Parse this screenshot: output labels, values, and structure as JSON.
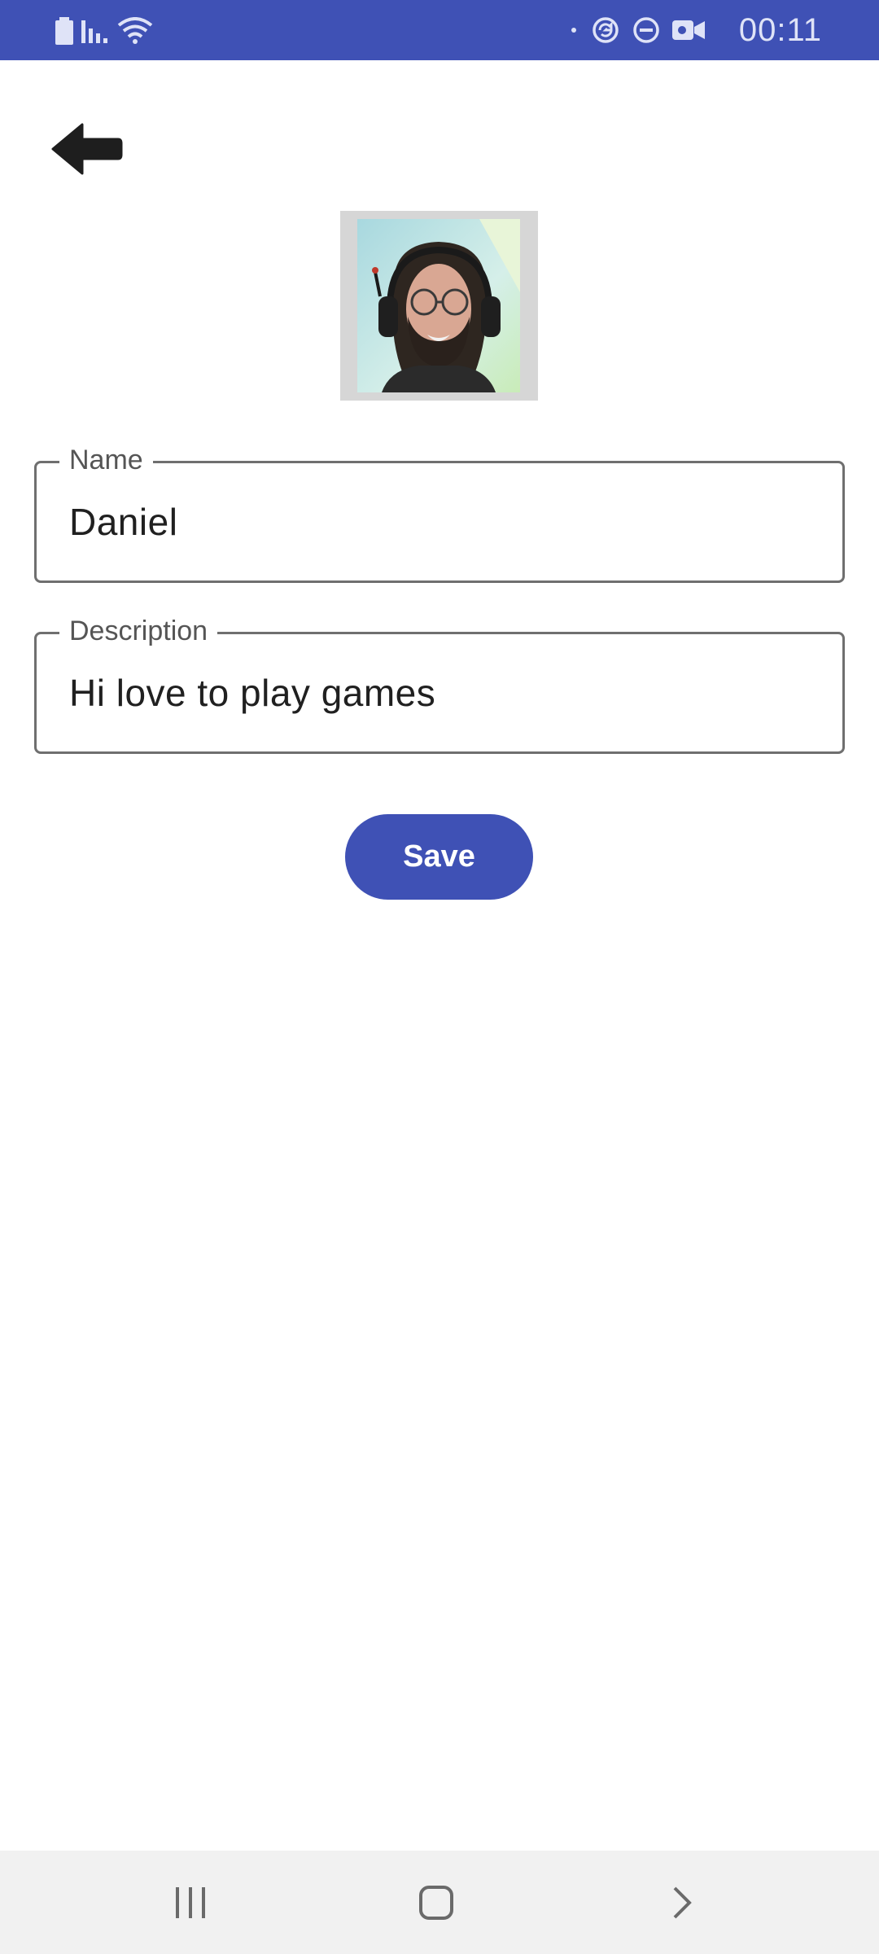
{
  "status_bar": {
    "time": "00:11",
    "left_icons": [
      "battery-icon",
      "signal-icon",
      "wifi-icon"
    ],
    "right_icons": [
      "dot-icon",
      "sync-icon",
      "do-not-disturb-icon",
      "video-camera-icon"
    ],
    "background_color": "#3f51b5"
  },
  "header": {
    "back_icon": "back-arrow-icon"
  },
  "profile": {
    "avatar_icon": "profile-photo"
  },
  "form": {
    "name": {
      "label": "Name",
      "value": "Daniel"
    },
    "description": {
      "label": "Description",
      "value": "Hi love to play games"
    },
    "save_label": "Save"
  },
  "nav_bar": {
    "items": [
      "recents-icon",
      "home-icon",
      "back-chevron-icon"
    ]
  },
  "colors": {
    "accent": "#3f51b5",
    "field_border": "#6f6f6f"
  }
}
